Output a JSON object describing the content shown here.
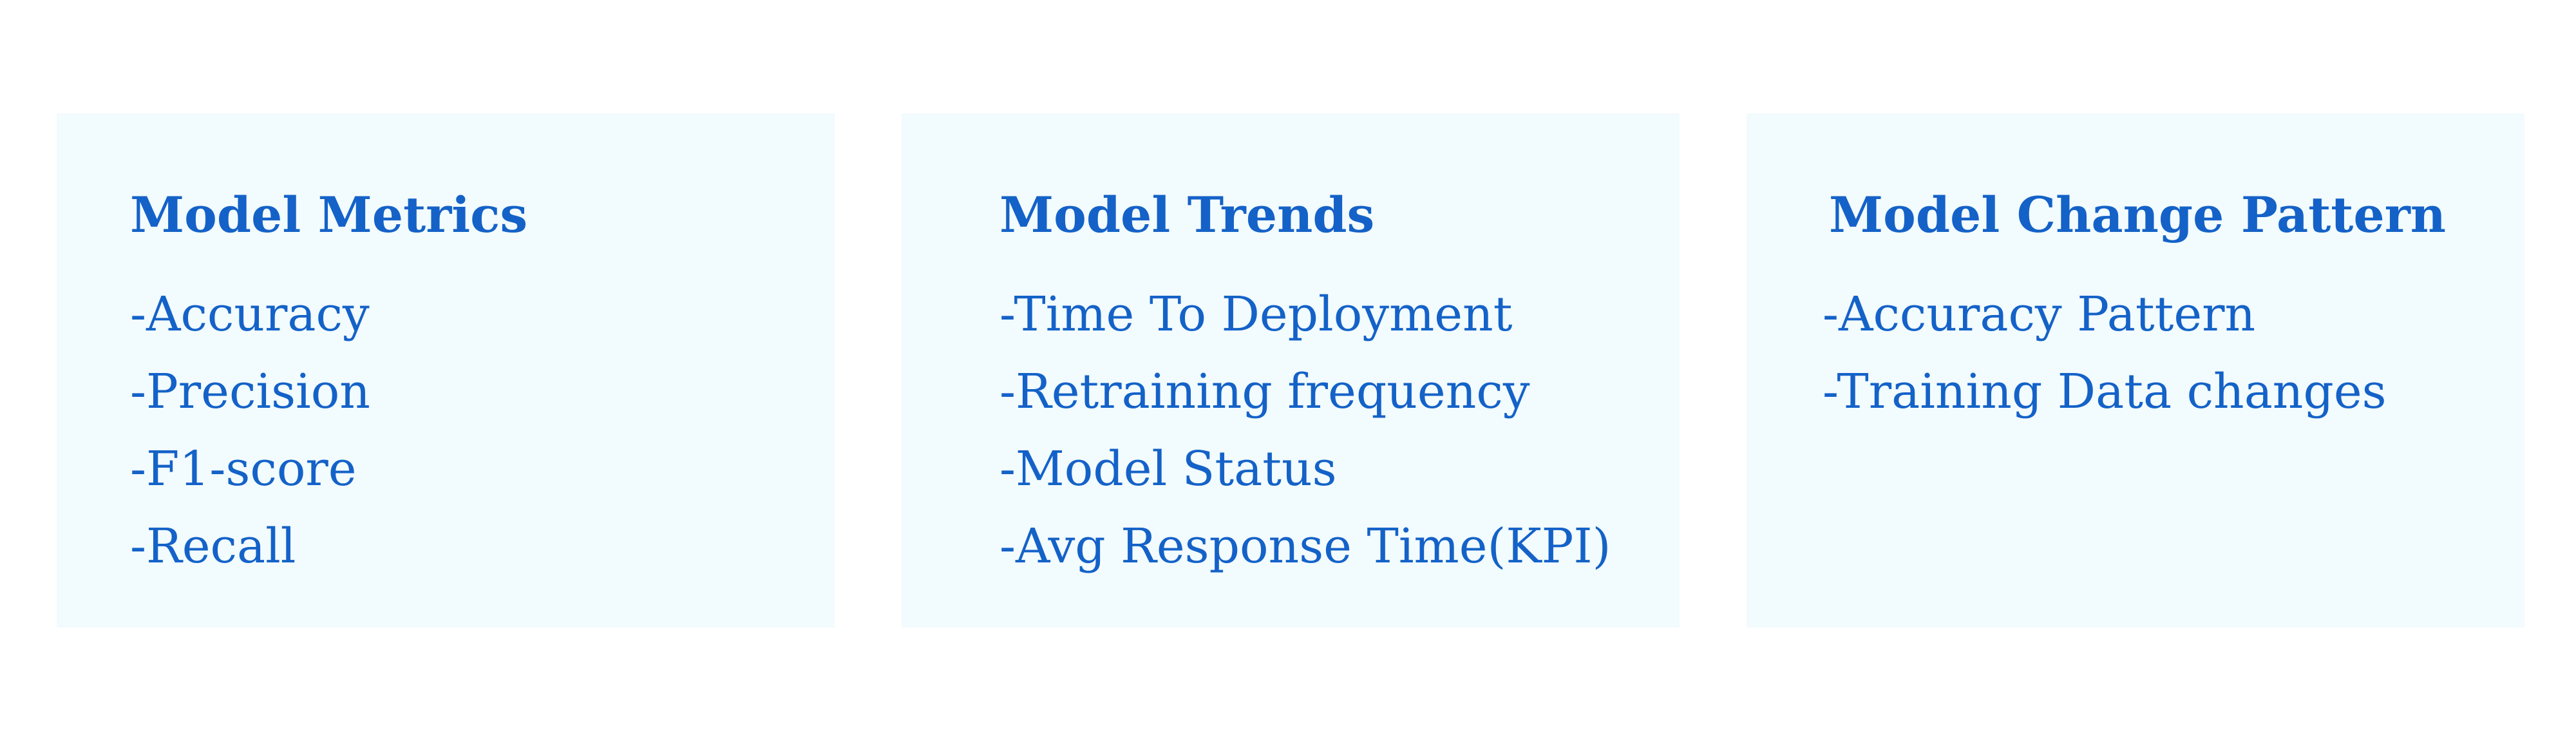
{
  "cards": [
    {
      "title": "Model Metrics",
      "items": [
        "-Accuracy",
        "-Precision",
        "-F1-score",
        "-Recall"
      ]
    },
    {
      "title": "Model Trends",
      "items": [
        "-Time To Deployment",
        "-Retraining frequency",
        "-Model Status",
        "-Avg Response Time(KPI)"
      ]
    },
    {
      "title": "Model Change Pattern",
      "items": [
        "-Accuracy Pattern",
        "-Training Data changes"
      ]
    }
  ],
  "colors": {
    "card_background": "#f2fbfd",
    "text": "#1462c8",
    "page_background": "#ffffff"
  }
}
